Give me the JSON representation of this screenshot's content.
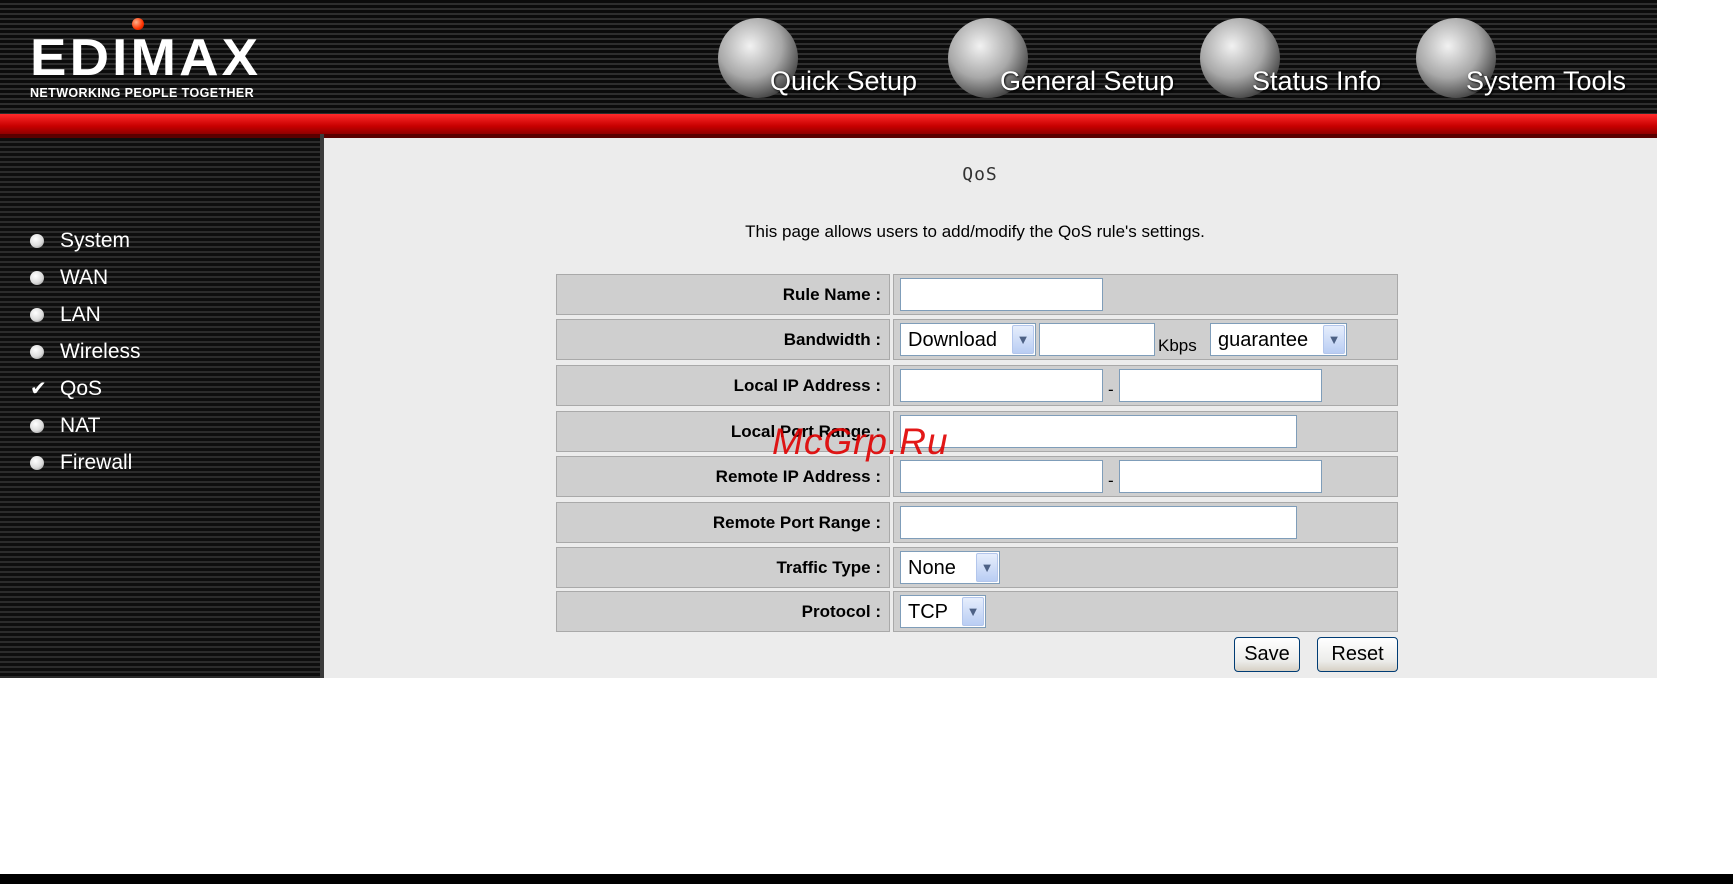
{
  "brand": {
    "logo_text": "EDIMAX",
    "tagline": "NETWORKING PEOPLE TOGETHER"
  },
  "topnav": [
    {
      "label": "Quick Setup",
      "icon": "hand-icon"
    },
    {
      "label": "General Setup",
      "icon": "keyboard-icon"
    },
    {
      "label": "Status Info",
      "icon": "network-plug-icon"
    },
    {
      "label": "System Tools",
      "icon": "tools-icon"
    }
  ],
  "sidebar": {
    "items": [
      {
        "label": "System",
        "selected": false
      },
      {
        "label": "WAN",
        "selected": false
      },
      {
        "label": "LAN",
        "selected": false
      },
      {
        "label": "Wireless",
        "selected": false
      },
      {
        "label": "QoS",
        "selected": true
      },
      {
        "label": "NAT",
        "selected": false
      },
      {
        "label": "Firewall",
        "selected": false
      }
    ]
  },
  "page": {
    "title": "QoS",
    "description": "This page allows users to add/modify the QoS rule's settings."
  },
  "form": {
    "rule_name": {
      "label": "Rule Name :",
      "value": ""
    },
    "bandwidth": {
      "label": "Bandwidth :",
      "direction": "Download",
      "value": "",
      "unit": "Kbps",
      "mode": "guarantee"
    },
    "local_ip": {
      "label": "Local IP Address :",
      "start": "",
      "end": "",
      "separator": "-"
    },
    "local_port": {
      "label": "Local Port Range :",
      "value": ""
    },
    "remote_ip": {
      "label": "Remote IP Address :",
      "start": "",
      "end": "",
      "separator": "-"
    },
    "remote_port": {
      "label": "Remote Port Range :",
      "value": ""
    },
    "traffic_type": {
      "label": "Traffic Type :",
      "value": "None"
    },
    "protocol": {
      "label": "Protocol :",
      "value": "TCP"
    }
  },
  "actions": {
    "save_label": "Save",
    "reset_label": "Reset"
  },
  "watermark": "McGrp.Ru",
  "colors": {
    "accent_red": "#e00000",
    "header_dark": "#0c0c0c",
    "cell_gray": "#cfcfcf",
    "page_bg": "#ececec"
  }
}
